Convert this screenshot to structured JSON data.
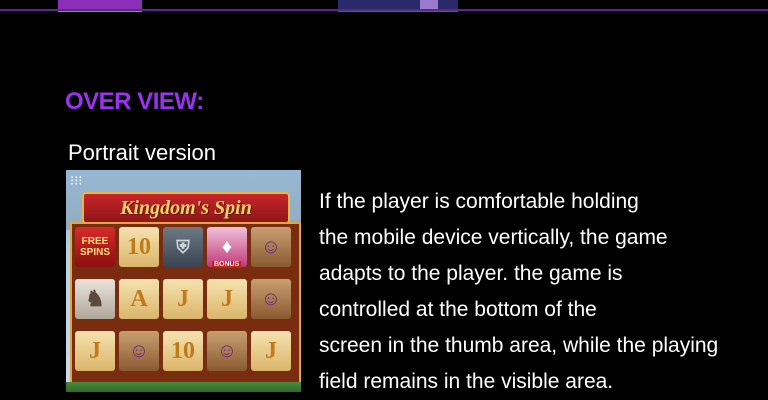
{
  "section": {
    "heading": "OVER VIEW:",
    "subheading": "Portrait version"
  },
  "description": {
    "lines": [
      "If the player is comfortable holding",
      "the mobile device vertically, the game",
      "adapts to the player. the game is",
      "controlled at the bottom of the",
      "screen in the thumb area, while the playing",
      "field remains in the visible area."
    ]
  },
  "game_thumbnail": {
    "title": "Kingdom's Spin",
    "free_spins_label": "FREE\nSPINS",
    "bonus_label": "BONUS",
    "symbols": {
      "row1": [
        "FREE SPINS",
        "10",
        "knight",
        "gem",
        "character"
      ],
      "row2": [
        "horse",
        "A",
        "J",
        "J",
        "character"
      ],
      "row3": [
        "J",
        "character",
        "10",
        "character",
        "J"
      ]
    }
  },
  "colors": {
    "heading": "#9933ee",
    "background": "#000000",
    "text": "#ffffff"
  }
}
